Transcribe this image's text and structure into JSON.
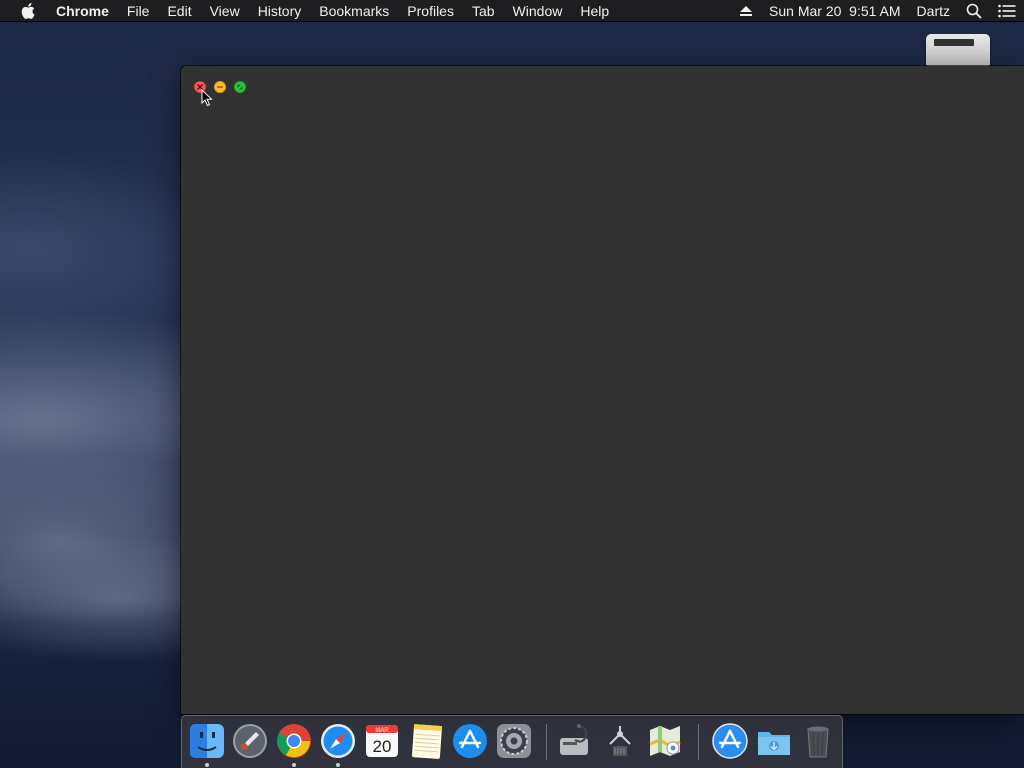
{
  "menubar": {
    "app_name": "Chrome",
    "items": [
      "File",
      "Edit",
      "View",
      "History",
      "Bookmarks",
      "Profiles",
      "Tab",
      "Window",
      "Help"
    ],
    "datetime": "Sun Mar 20  9:51 AM",
    "user": "Dartz",
    "icons": [
      "apple-icon",
      "eject-icon",
      "spotlight-search-icon",
      "notification-center-icon"
    ]
  },
  "window": {
    "app": "Chrome",
    "controls": [
      "close",
      "minimize",
      "fullscreen"
    ],
    "background": "#323232"
  },
  "dock": {
    "items": [
      {
        "name": "finder-icon",
        "running": true
      },
      {
        "name": "launchpad-icon",
        "running": false
      },
      {
        "name": "chrome-icon",
        "running": true
      },
      {
        "name": "safari-icon",
        "running": true
      },
      {
        "name": "calendar-icon",
        "running": false,
        "month": "MAR",
        "day": "20"
      },
      {
        "name": "notes-icon",
        "running": false
      },
      {
        "name": "app-store-icon",
        "running": false
      },
      {
        "name": "system-preferences-icon",
        "running": false
      },
      {
        "name": "disk-utility-icon",
        "running": false
      },
      {
        "name": "system-information-icon",
        "running": false
      },
      {
        "name": "maps-icon",
        "running": false
      },
      {
        "name": "app-store-downloads-icon",
        "running": false
      },
      {
        "name": "downloads-folder-icon",
        "running": false
      },
      {
        "name": "trash-icon",
        "running": false
      }
    ]
  },
  "colors": {
    "close": "#fc5f57",
    "minimize": "#fdbc2e",
    "fullscreen": "#28c840",
    "window_bg": "#323232",
    "menubar_bg": "#1e1e20"
  }
}
